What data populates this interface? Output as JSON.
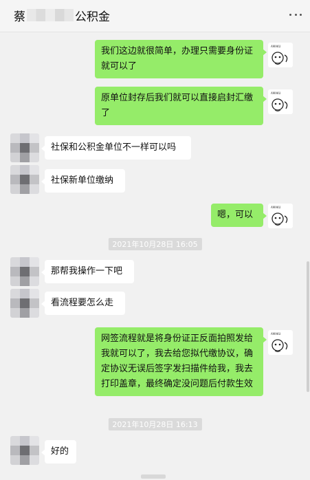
{
  "header": {
    "title_prefix": "蔡",
    "title_suffix": "公积金",
    "more_icon": "more-dots-icon"
  },
  "messages": [
    {
      "side": "out",
      "text": "我们这边就很简单，办理只需要身份证就可以了"
    },
    {
      "side": "out",
      "text": "原单位封存后我们就可以直接启封汇缴了"
    },
    {
      "side": "in",
      "text": "社保和公积金单位不一样可以吗"
    },
    {
      "side": "in",
      "text": "社保新单位缴纳"
    },
    {
      "side": "out",
      "text": "嗯，可以"
    },
    {
      "side": "in",
      "text": "那帮我操作一下吧"
    },
    {
      "side": "in",
      "text": "看流程要怎么走"
    },
    {
      "side": "out",
      "text": "网签流程就是将身份证正反面拍照发给我就可以了，我去给您拟代缴协议，确定协议无误后签字发扫描件给我，我去打印盖章，最终确定没问题后付款生效"
    },
    {
      "side": "in",
      "text": "好的"
    }
  ],
  "timestamps": [
    "2021年10月28日 16:05",
    "2021年10月28日 16:13"
  ],
  "colors": {
    "out_bubble": "#95ec69",
    "in_bubble": "#ffffff",
    "background": "#f1f1f1"
  }
}
